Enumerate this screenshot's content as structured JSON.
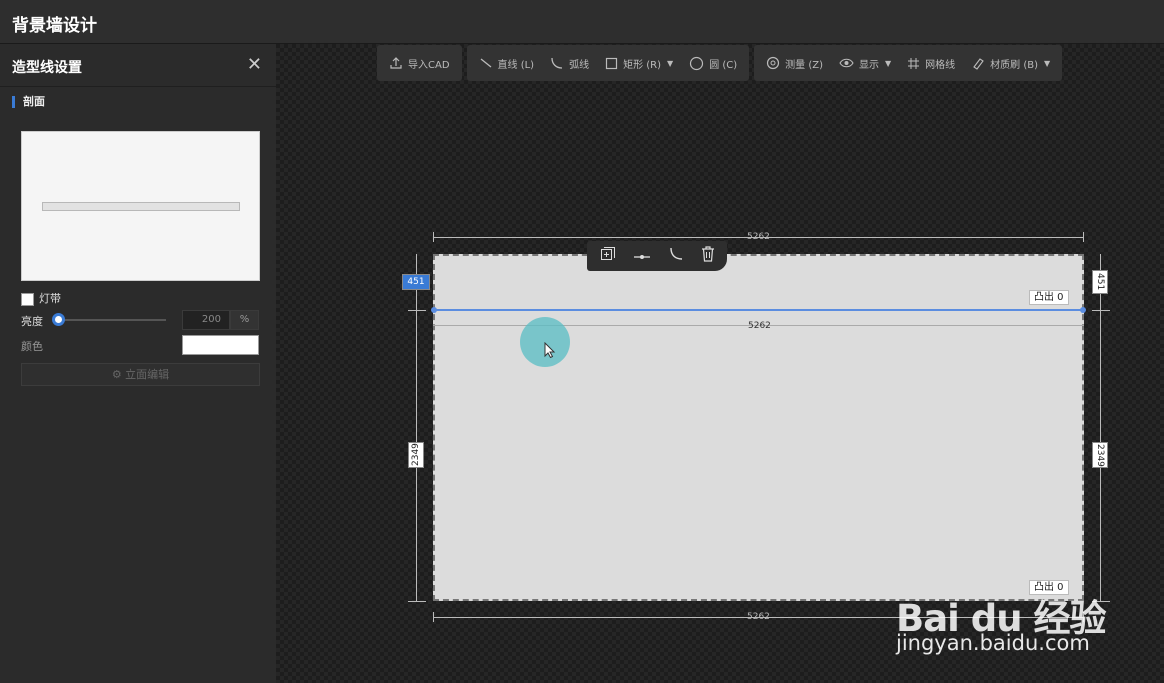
{
  "app": {
    "title": "背景墙设计"
  },
  "panel": {
    "title": "造型线设置",
    "section": "剖面",
    "light_strip_label": "灯带",
    "brightness_label": "亮度",
    "brightness_value": "200",
    "brightness_unit": "%",
    "color_label": "颜色",
    "color_value": "#ffffff",
    "elevation_button": "立面编辑"
  },
  "toolbar": {
    "import_cad": "导入CAD",
    "line": "直线 (L)",
    "arc": "弧线",
    "rect": "矩形 (R)",
    "circle": "圆 (C)",
    "measure": "测量 (Z)",
    "display": "显示",
    "grid": "网格线",
    "material": "材质刷 (B)"
  },
  "canvas": {
    "top_dim": "5262",
    "bottom_dim": "5262",
    "inner_dim": "5262",
    "left_top_dim": "451",
    "left_bottom_dim": "2349",
    "right_top_dim": "451",
    "right_bottom_dim": "2349",
    "top_tag": "凸出 0",
    "bottom_tag": "凸出 0"
  },
  "watermark": {
    "brand": "Bai du 经验",
    "url": "jingyan.baidu.com"
  },
  "colors": {
    "accent": "#3a7bd5",
    "cursor": "#58bec4"
  }
}
